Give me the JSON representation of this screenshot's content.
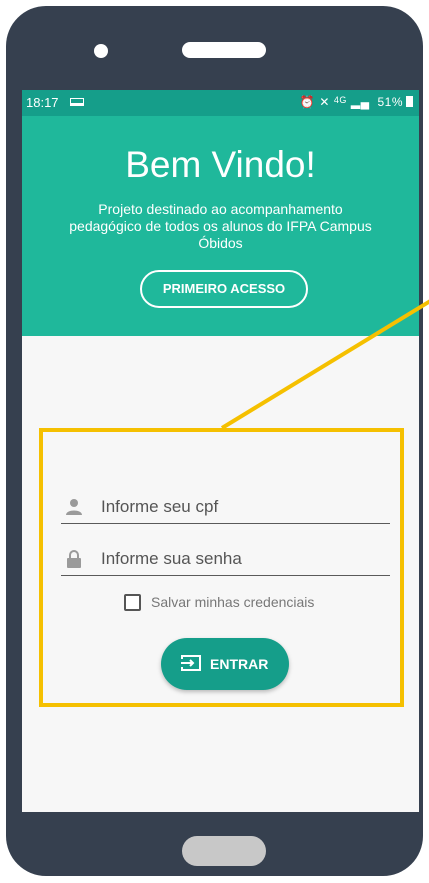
{
  "status_bar": {
    "time": "18:17",
    "battery_percent": "51%",
    "signal_label": "4G",
    "icons": [
      "laptop-icon",
      "alarm-icon",
      "mute-icon",
      "signal-icon",
      "battery-icon"
    ]
  },
  "hero": {
    "title": "Bem Vindo!",
    "description": "Projeto destinado ao acompanhamento pedagógico de todos os alunos do IFPA Campus Óbidos",
    "first_access_label": "PRIMEIRO ACESSO"
  },
  "login": {
    "cpf_placeholder": "Informe seu cpf",
    "password_placeholder": "Informe sua senha",
    "remember_label": "Salvar minhas credenciais",
    "remember_checked": false,
    "enter_label": "ENTRAR"
  },
  "colors": {
    "primary": "#1fb89b",
    "primary_dark": "#159e8a",
    "highlight": "#f5c000",
    "device_frame": "#36404f"
  }
}
